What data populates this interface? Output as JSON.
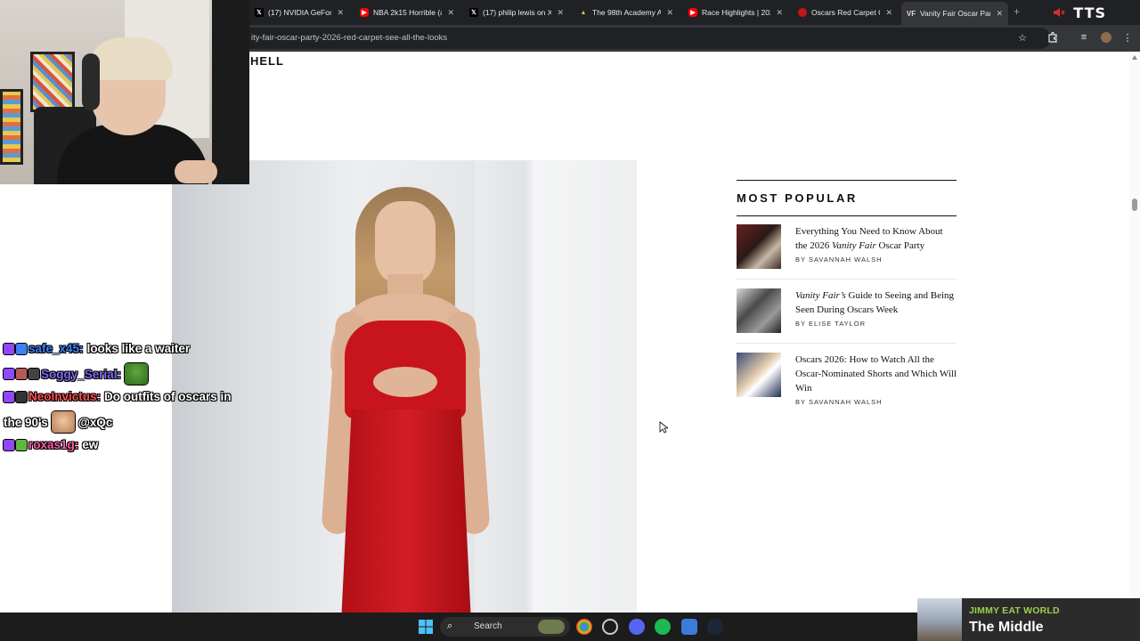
{
  "browser": {
    "tabs": [
      {
        "title": "(17) NVIDIA GeForce",
        "icon": "x-icon",
        "color": "#000000"
      },
      {
        "title": "NBA 2k15 Horrible (a",
        "icon": "youtube-icon",
        "color": "#ff0000"
      },
      {
        "title": "(17) philip lewis on X",
        "icon": "x-icon",
        "color": "#000000"
      },
      {
        "title": "The 98th Academy A",
        "icon": "academy-icon",
        "color": "#c9a227"
      },
      {
        "title": "Race Highlights | 202",
        "icon": "youtube-icon",
        "color": "#ff0000"
      },
      {
        "title": "Oscars Red Carpet O",
        "icon": "vanity-fair-icon",
        "color": "#c4161c"
      },
      {
        "title": "Vanity Fair Oscar Part",
        "icon": "vf-icon",
        "color": "#111111"
      }
    ],
    "new_tab_label": "+",
    "tts_label": "TTS",
    "url": "ity-fair-oscar-party-2026-red-carpet-see-all-the-looks"
  },
  "page": {
    "logo_fragment": "HELL",
    "most_popular": {
      "heading": "MOST POPULAR",
      "items": [
        {
          "title_line1": "Everything You Need to Know About",
          "title_pre": "the 2026 ",
          "title_em": "Vanity Fair",
          "title_post": " Oscar Party",
          "byline": "BY SAVANNAH WALSH"
        },
        {
          "title_em": "Vanity Fair’s",
          "title_post": " Guide to Seeing and Being Seen During Oscars Week",
          "byline": "BY ELISE TAYLOR"
        },
        {
          "title": "Oscars 2026: How to Watch All the Oscar-Nominated Shorts and Which Will Win",
          "byline": "BY SAVANNAH WALSH"
        }
      ]
    }
  },
  "chat": {
    "messages": [
      {
        "user": "safe_x45:",
        "text": "looks like a waiter",
        "color": "#3b82f6"
      },
      {
        "user": "Soggy_Serial:",
        "text": "",
        "color": "#7c6cf5"
      },
      {
        "user": "NeoInvictus:",
        "text": "Do outfits of oscars in",
        "color": "#ff4f4f"
      },
      {
        "user": "",
        "text": "the 90's",
        "suffix": "@xQc"
      },
      {
        "user": "roxas1g:",
        "text": "ew",
        "color": "#ff5fa8"
      }
    ]
  },
  "now_playing": {
    "artist": "JIMMY EAT WORLD",
    "track": "The Middle"
  },
  "taskbar": {
    "search_label": "Search"
  },
  "colors": {
    "accent_red": "#c4161c",
    "spotify_green": "#1db954"
  }
}
